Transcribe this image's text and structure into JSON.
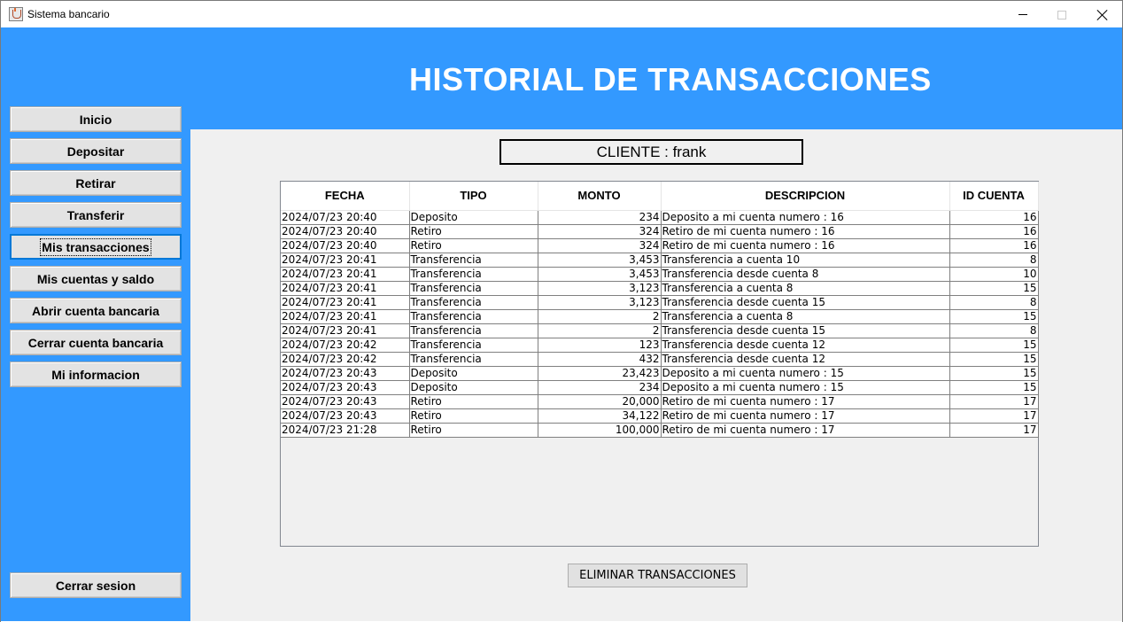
{
  "window": {
    "title": "Sistema bancario"
  },
  "header": {
    "title": "HISTORIAL DE TRANSACCIONES"
  },
  "sidebar": {
    "items": [
      {
        "label": "Inicio"
      },
      {
        "label": "Depositar"
      },
      {
        "label": "Retirar"
      },
      {
        "label": "Transferir"
      },
      {
        "label": "Mis transacciones",
        "active": true
      },
      {
        "label": "Mis cuentas y saldo"
      },
      {
        "label": "Abrir cuenta bancaria"
      },
      {
        "label": "Cerrar cuenta bancaria"
      },
      {
        "label": "Mi informacion"
      }
    ],
    "logout_label": "Cerrar sesion"
  },
  "client": {
    "label": "CLIENTE : frank"
  },
  "table": {
    "columns": [
      "FECHA",
      "TIPO",
      "MONTO",
      "DESCRIPCION",
      "ID CUENTA"
    ],
    "rows": [
      [
        "2024/07/23 20:40",
        "Deposito",
        "234",
        "Deposito a mi cuenta numero : 16",
        "16"
      ],
      [
        "2024/07/23 20:40",
        "Retiro",
        "324",
        "Retiro de mi cuenta numero : 16",
        "16"
      ],
      [
        "2024/07/23 20:40",
        "Retiro",
        "324",
        "Retiro de mi cuenta numero : 16",
        "16"
      ],
      [
        "2024/07/23 20:41",
        "Transferencia",
        "3,453",
        "Transferencia a cuenta 10",
        "8"
      ],
      [
        "2024/07/23 20:41",
        "Transferencia",
        "3,453",
        "Transferencia desde cuenta 8",
        "10"
      ],
      [
        "2024/07/23 20:41",
        "Transferencia",
        "3,123",
        "Transferencia a cuenta 8",
        "15"
      ],
      [
        "2024/07/23 20:41",
        "Transferencia",
        "3,123",
        "Transferencia desde cuenta 15",
        "8"
      ],
      [
        "2024/07/23 20:41",
        "Transferencia",
        "2",
        "Transferencia a cuenta 8",
        "15"
      ],
      [
        "2024/07/23 20:41",
        "Transferencia",
        "2",
        "Transferencia desde cuenta 15",
        "8"
      ],
      [
        "2024/07/23 20:42",
        "Transferencia",
        "123",
        "Transferencia desde cuenta 12",
        "15"
      ],
      [
        "2024/07/23 20:42",
        "Transferencia",
        "432",
        "Transferencia desde cuenta 12",
        "15"
      ],
      [
        "2024/07/23 20:43",
        "Deposito",
        "23,423",
        "Deposito a mi cuenta numero : 15",
        "15"
      ],
      [
        "2024/07/23 20:43",
        "Deposito",
        "234",
        "Deposito a mi cuenta numero : 15",
        "15"
      ],
      [
        "2024/07/23 20:43",
        "Retiro",
        "20,000",
        "Retiro de mi cuenta numero : 17",
        "17"
      ],
      [
        "2024/07/23 20:43",
        "Retiro",
        "34,122",
        "Retiro de mi cuenta numero : 17",
        "17"
      ],
      [
        "2024/07/23 21:28",
        "Retiro",
        "100,000",
        "Retiro de mi cuenta numero : 17",
        "17"
      ]
    ]
  },
  "actions": {
    "delete_label": "ELIMINAR TRANSACCIONES"
  },
  "icons": {
    "app": "java-coffee-icon",
    "minimize": "minimize-icon",
    "maximize": "maximize-icon",
    "close": "close-icon"
  },
  "colors": {
    "accent": "#3399ff",
    "panel": "#f0f0f0"
  }
}
